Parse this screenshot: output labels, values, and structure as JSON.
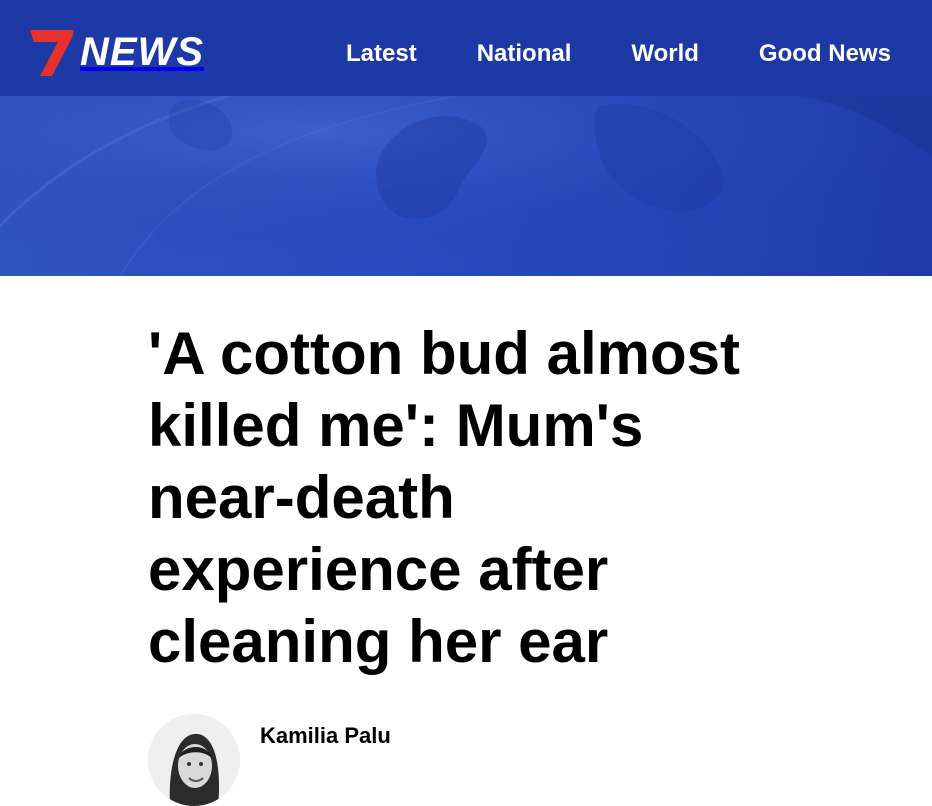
{
  "header": {
    "logo_text": "NEWS",
    "brand_accent": "#e6322d",
    "background": "#1d39a6",
    "nav": [
      {
        "label": "Latest"
      },
      {
        "label": "National"
      },
      {
        "label": "World"
      },
      {
        "label": "Good News"
      }
    ]
  },
  "hero": {
    "color": "#2a4cc0"
  },
  "article": {
    "headline": "'A cotton bud almost killed me': Mum's near-death experience after cleaning her ear",
    "author": {
      "name": "Kamilia Palu"
    }
  }
}
